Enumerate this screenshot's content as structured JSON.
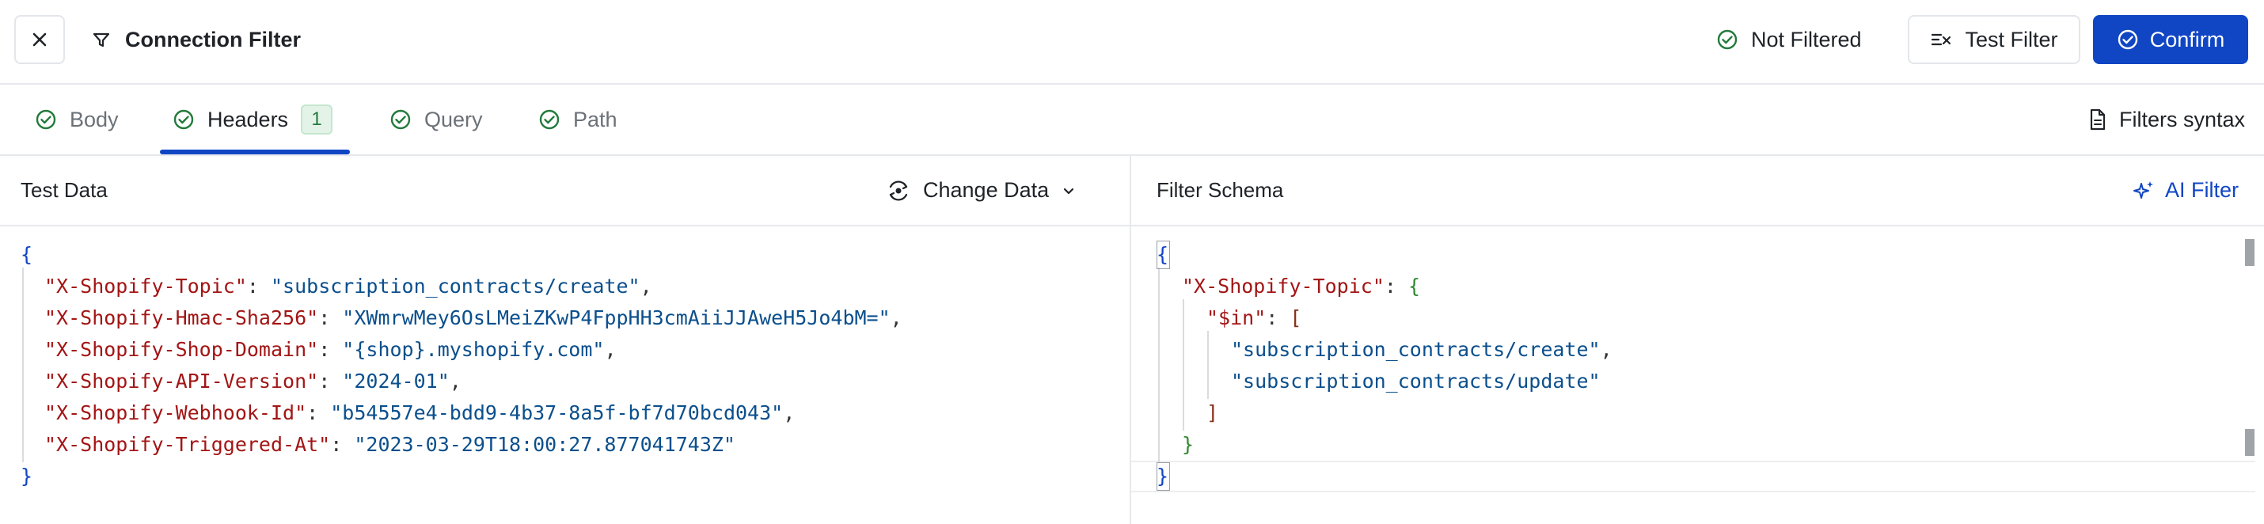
{
  "topbar": {
    "title": "Connection Filter",
    "status_label": "Not Filtered",
    "test_filter_label": "Test Filter",
    "confirm_label": "Confirm"
  },
  "tabs": [
    {
      "label": "Body",
      "active": false
    },
    {
      "label": "Headers",
      "active": true,
      "badge": "1"
    },
    {
      "label": "Query",
      "active": false
    },
    {
      "label": "Path",
      "active": false
    }
  ],
  "filters_syntax_label": "Filters syntax",
  "left_panel": {
    "title": "Test Data",
    "change_data_label": "Change Data",
    "code": {
      "open": "{",
      "close": "}",
      "entries": [
        {
          "key": "\"X-Shopify-Topic\"",
          "value": "\"subscription_contracts/create\""
        },
        {
          "key": "\"X-Shopify-Hmac-Sha256\"",
          "value": "\"XWmrwMey6OsLMeiZKwP4FppHH3cmAiiJJAweH5Jo4bM=\""
        },
        {
          "key": "\"X-Shopify-Shop-Domain\"",
          "value": "\"{shop}.myshopify.com\""
        },
        {
          "key": "\"X-Shopify-API-Version\"",
          "value": "\"2024-01\""
        },
        {
          "key": "\"X-Shopify-Webhook-Id\"",
          "value": "\"b54557e4-bdd9-4b37-8a5f-bf7d70bcd043\""
        },
        {
          "key": "\"X-Shopify-Triggered-At\"",
          "value": "\"2023-03-29T18:00:27.877041743Z\""
        }
      ]
    }
  },
  "right_panel": {
    "title": "Filter Schema",
    "ai_filter_label": "AI Filter",
    "code": {
      "open": "{",
      "topic_key": "\"X-Shopify-Topic\"",
      "topic_open": "{",
      "in_key": "\"$in\"",
      "array_open": "[",
      "items": [
        "\"subscription_contracts/create\"",
        "\"subscription_contracts/update\""
      ],
      "array_close": "]",
      "topic_close": "}",
      "close": "}"
    }
  },
  "colors": {
    "accent": "#1046c4",
    "success": "#227a3b",
    "json_key": "#a31515",
    "json_string": "#0b4f8c"
  }
}
